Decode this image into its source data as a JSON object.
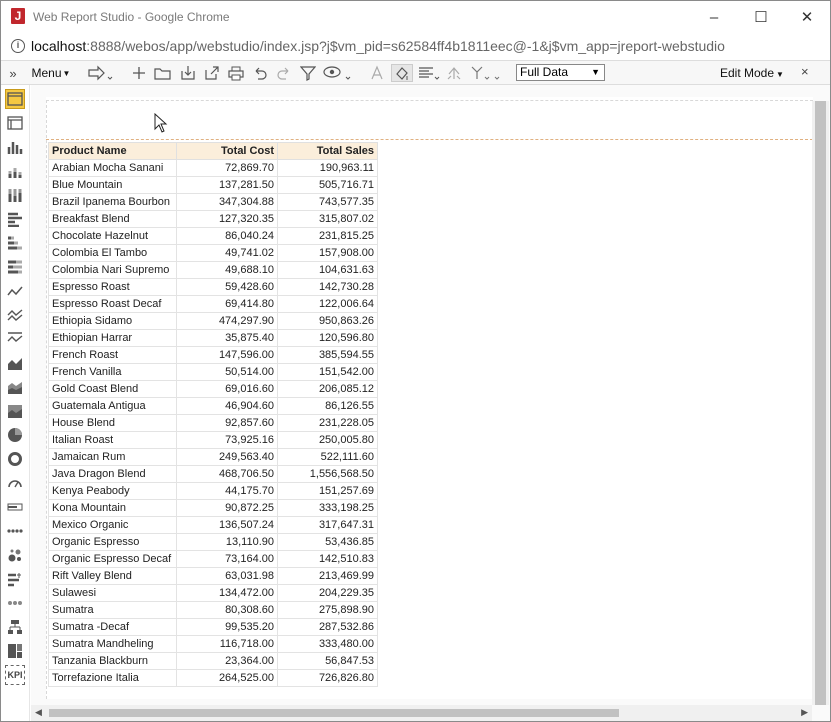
{
  "window": {
    "title": "Web Report Studio - Google Chrome",
    "app_icon": "J",
    "minimize": "–",
    "maximize": "☐",
    "close": "✕"
  },
  "address": {
    "host": "localhost",
    "rest": ":8888/webos/app/webstudio/index.jsp?j$vm_pid=s62584ff4b1811eec@-1&j$vm_app=jreport-webstudio"
  },
  "toolbar": {
    "expand": "»",
    "menu_label": "Menu",
    "data_select": "Full Data",
    "edit_mode": "Edit Mode",
    "close": "×"
  },
  "table": {
    "headers": [
      "Product Name",
      "Total Cost",
      "Total Sales"
    ],
    "rows": [
      [
        "Arabian Mocha Sanani",
        "72,869.70",
        "190,963.11"
      ],
      [
        "Blue Mountain",
        "137,281.50",
        "505,716.71"
      ],
      [
        "Brazil Ipanema Bourbon",
        "347,304.88",
        "743,577.35"
      ],
      [
        "Breakfast Blend",
        "127,320.35",
        "315,807.02"
      ],
      [
        "Chocolate Hazelnut",
        "86,040.24",
        "231,815.25"
      ],
      [
        "Colombia El Tambo",
        "49,741.02",
        "157,908.00"
      ],
      [
        "Colombia Nari Supremo",
        "49,688.10",
        "104,631.63"
      ],
      [
        "Espresso Roast",
        "59,428.60",
        "142,730.28"
      ],
      [
        "Espresso Roast Decaf",
        "69,414.80",
        "122,006.64"
      ],
      [
        "Ethiopia Sidamo",
        "474,297.90",
        "950,863.26"
      ],
      [
        "Ethiopian Harrar",
        "35,875.40",
        "120,596.80"
      ],
      [
        "French Roast",
        "147,596.00",
        "385,594.55"
      ],
      [
        "French Vanilla",
        "50,514.00",
        "151,542.00"
      ],
      [
        "Gold Coast Blend",
        "69,016.60",
        "206,085.12"
      ],
      [
        "Guatemala Antigua",
        "46,904.60",
        "86,126.55"
      ],
      [
        "House Blend",
        "92,857.60",
        "231,228.05"
      ],
      [
        "Italian Roast",
        "73,925.16",
        "250,005.80"
      ],
      [
        "Jamaican Rum",
        "249,563.40",
        "522,111.60"
      ],
      [
        "Java Dragon Blend",
        "468,706.50",
        "1,556,568.50"
      ],
      [
        "Kenya Peabody",
        "44,175.70",
        "151,257.69"
      ],
      [
        "Kona Mountain",
        "90,872.25",
        "333,198.25"
      ],
      [
        "Mexico Organic",
        "136,507.24",
        "317,647.31"
      ],
      [
        "Organic Espresso",
        "13,110.90",
        "53,436.85"
      ],
      [
        "Organic Espresso Decaf",
        "73,164.00",
        "142,510.83"
      ],
      [
        "Rift Valley Blend",
        "63,031.98",
        "213,469.99"
      ],
      [
        "Sulawesi",
        "134,472.00",
        "204,229.35"
      ],
      [
        "Sumatra",
        "80,308.60",
        "275,898.90"
      ],
      [
        "Sumatra -Decaf",
        "99,535.20",
        "287,532.86"
      ],
      [
        "Sumatra Mandheling",
        "116,718.00",
        "333,480.00"
      ],
      [
        "Tanzania Blackburn",
        "23,364.00",
        "56,847.53"
      ],
      [
        "Torrefazione Italia",
        "264,525.00",
        "726,826.80"
      ]
    ]
  },
  "sidebar": {
    "kpi_label": "KPI"
  },
  "colors": {
    "header_bg": "#fbeedb",
    "active_tool": "#f5c842",
    "app_icon": "#c1272d"
  }
}
